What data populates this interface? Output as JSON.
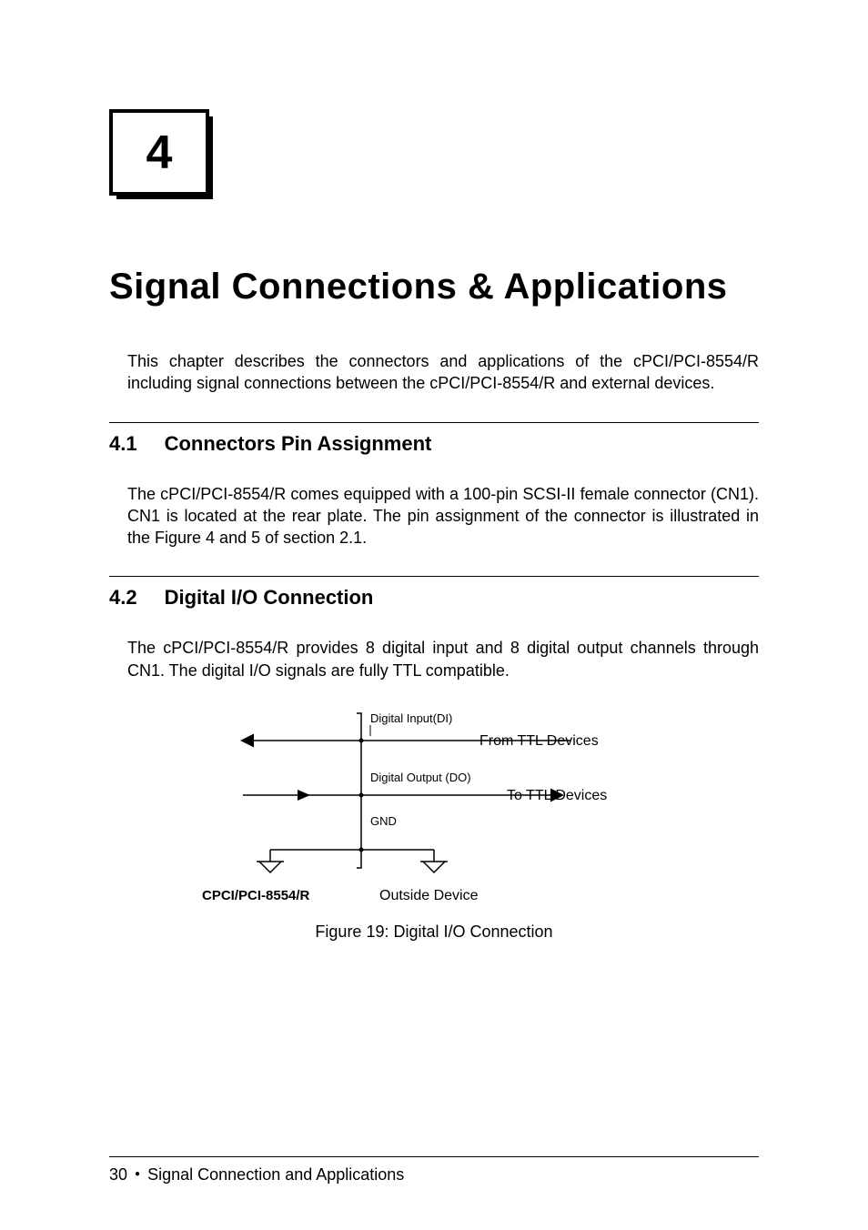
{
  "chapter": {
    "number": "4"
  },
  "title": "Signal Connections & Applications",
  "intro": "This chapter describes the connectors and applications of the cPCI/PCI-8554/R including signal connections between the cPCI/PCI-8554/R and external devices.",
  "sections": [
    {
      "number": "4.1",
      "title": "Connectors Pin Assignment",
      "text": "The cPCI/PCI-8554/R comes equipped with a 100-pin SCSI-II female connector (CN1).  CN1 is located at the rear plate.  The pin assignment of the connector is illustrated in the Figure 4 and 5 of section 2.1."
    },
    {
      "number": "4.2",
      "title": "Digital I/O Connection",
      "text": "The cPCI/PCI-8554/R provides 8 digital input and 8 digital output channels through CN1. The digital I/O signals are fully TTL compatible."
    }
  ],
  "diagram": {
    "labels": {
      "di": "Digital Input(DI)",
      "from_ttl": "From TTL Devices",
      "do": "Digital Output (DO)",
      "to_ttl": "To TTL Devices",
      "gnd": "GND",
      "device_left": "CPCI/PCI-8554/R",
      "device_right": "Outside Device"
    }
  },
  "figure_caption": "Figure 19:    Digital I/O Connection",
  "footer": {
    "page": "30",
    "section": "Signal Connection and Applications"
  }
}
